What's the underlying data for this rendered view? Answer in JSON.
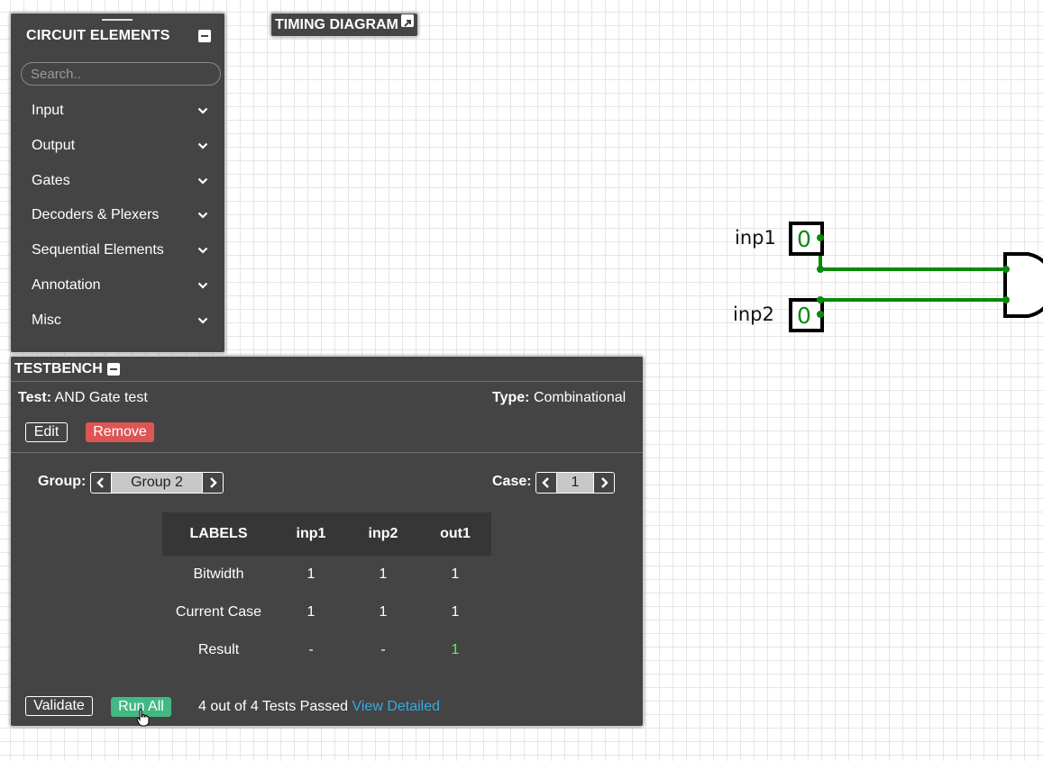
{
  "circuit_elements": {
    "title": "CIRCUIT ELEMENTS",
    "search_placeholder": "Search..",
    "categories": [
      {
        "label": "Input"
      },
      {
        "label": "Output"
      },
      {
        "label": "Gates"
      },
      {
        "label": "Decoders & Plexers"
      },
      {
        "label": "Sequential Elements"
      },
      {
        "label": "Annotation"
      },
      {
        "label": "Misc"
      }
    ]
  },
  "timing_diagram": {
    "title": "TIMING DIAGRAM"
  },
  "testbench": {
    "title": "TESTBENCH",
    "test_label": "Test:",
    "test_name": "AND Gate test",
    "type_label": "Type:",
    "type_value": "Combinational",
    "edit_label": "Edit",
    "remove_label": "Remove",
    "group_label": "Group:",
    "group_value": "Group 2",
    "case_label": "Case:",
    "case_value": "1",
    "table": {
      "headers": [
        "LABELS",
        "inp1",
        "inp2",
        "out1"
      ],
      "rows": [
        [
          "Bitwidth",
          "1",
          "1",
          "1"
        ],
        [
          "Current Case",
          "1",
          "1",
          "1"
        ],
        [
          "Result",
          "-",
          "-",
          "1"
        ]
      ]
    },
    "validate_label": "Validate",
    "run_all_label": "Run All",
    "status_text": "4 out of 4 Tests Passed",
    "view_detailed_label": "View Detailed"
  },
  "canvas": {
    "inputs": [
      {
        "label": "inp1",
        "value": "0"
      },
      {
        "label": "inp2",
        "value": "0"
      }
    ],
    "wire_color": "#008000",
    "gate": "AND"
  },
  "colors": {
    "panel_bg": "#444444",
    "remove": "#dc5656",
    "run_all": "#42b983",
    "pass": "#4cff4c",
    "link": "#3aa8e0"
  }
}
